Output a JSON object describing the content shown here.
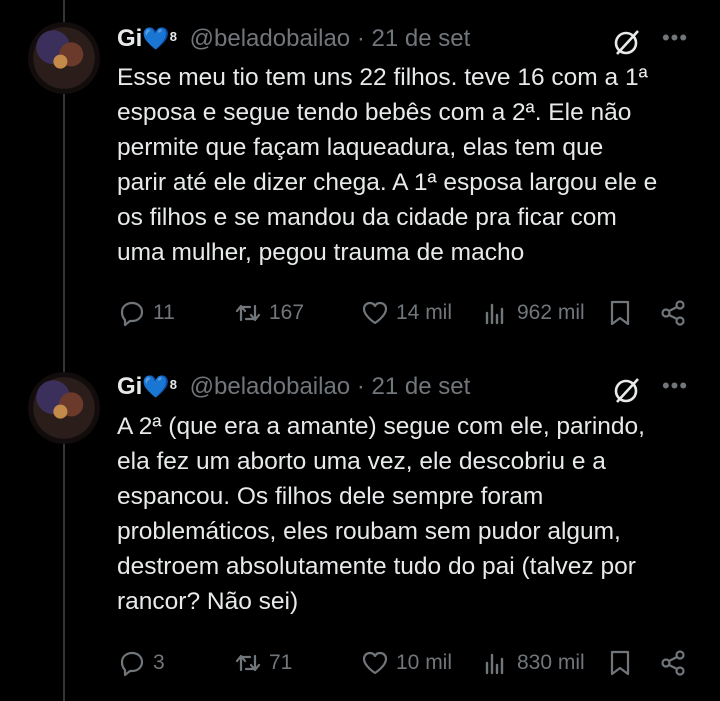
{
  "tweets": [
    {
      "author_name": "Gi",
      "author_badge": "8",
      "handle": "@beladobailao",
      "separator": "·",
      "date": "21 de set",
      "lines": [
        "Esse meu tio tem uns 22 filhos. teve 16 com a 1ª",
        "esposa e segue tendo bebês com a 2ª. Ele não",
        "permite que façam laqueadura, elas tem que",
        "parir até ele dizer chega. A 1ª esposa largou ele e",
        "os filhos e se mandou da cidade pra ficar com",
        "uma mulher, pegou trauma de macho"
      ],
      "replies": "11",
      "retweets": "167",
      "likes": "14 mil",
      "views": "962 mil"
    },
    {
      "author_name": "Gi",
      "author_badge": "8",
      "handle": "@beladobailao",
      "separator": "·",
      "date": "21 de set",
      "lines": [
        "A 2ª (que era a amante) segue com ele, parindo,",
        "ela fez um aborto uma vez, ele descobriu e a",
        "espancou. Os filhos dele sempre foram",
        "problemáticos, eles roubam sem pudor algum,",
        "destroem absolutamente tudo do pai (talvez por",
        "rancor? Não sei)"
      ],
      "replies": "3",
      "retweets": "71",
      "likes": "10 mil",
      "views": "830 mil"
    }
  ],
  "icons": {
    "heart_badge": "blue-heart-icon",
    "more": "more-icon",
    "grok": "grok-icon",
    "reply": "reply-icon",
    "retweet": "retweet-icon",
    "like": "like-icon",
    "views": "views-icon",
    "bookmark": "bookmark-icon",
    "share": "share-icon"
  },
  "colors": {
    "background": "#000000",
    "text": "#e7e9ea",
    "muted": "#71767b",
    "heart": "#1d9bf0",
    "thread_line": "#333639"
  }
}
